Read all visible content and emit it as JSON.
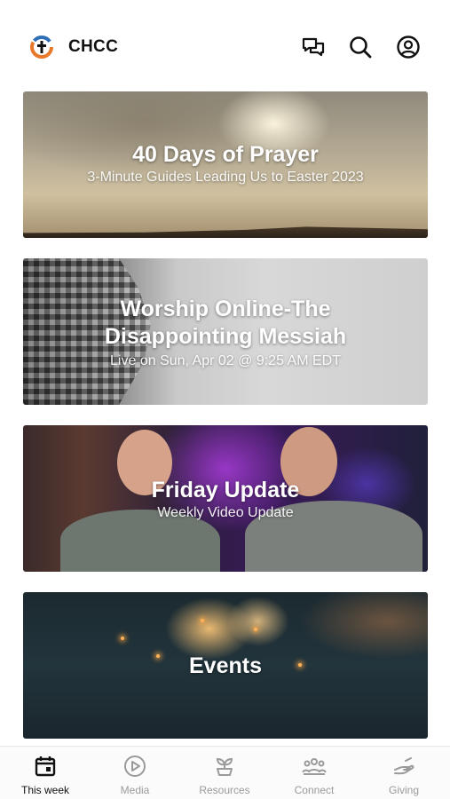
{
  "status_hint": "",
  "header": {
    "title": "CHCC",
    "logo_icon": "chcc-cross-logo",
    "icons": [
      "chat-icon",
      "search-icon",
      "account-icon"
    ]
  },
  "cards": [
    {
      "title": "40 Days of Prayer",
      "subtitle": "3-Minute Guides Leading Us to Easter 2023"
    },
    {
      "title": "Worship Online-The Disappointing Messiah",
      "subtitle": "Live on Sun, Apr 02 @ 9:25 AM EDT"
    },
    {
      "title": "Friday Update",
      "subtitle": "Weekly Video Update"
    },
    {
      "title": "Events",
      "subtitle": ""
    }
  ],
  "tabbar": {
    "items": [
      {
        "label": "This week",
        "icon": "calendar-icon",
        "active": true
      },
      {
        "label": "Media",
        "icon": "play-icon",
        "active": false
      },
      {
        "label": "Resources",
        "icon": "sprout-icon",
        "active": false
      },
      {
        "label": "Connect",
        "icon": "people-icon",
        "active": false
      },
      {
        "label": "Giving",
        "icon": "giving-icon",
        "active": false
      }
    ]
  },
  "colors": {
    "active_tab": "#111111",
    "inactive_tab": "#9a9a9a",
    "logo_orange": "#e8782a",
    "logo_blue": "#2e6fb5"
  }
}
